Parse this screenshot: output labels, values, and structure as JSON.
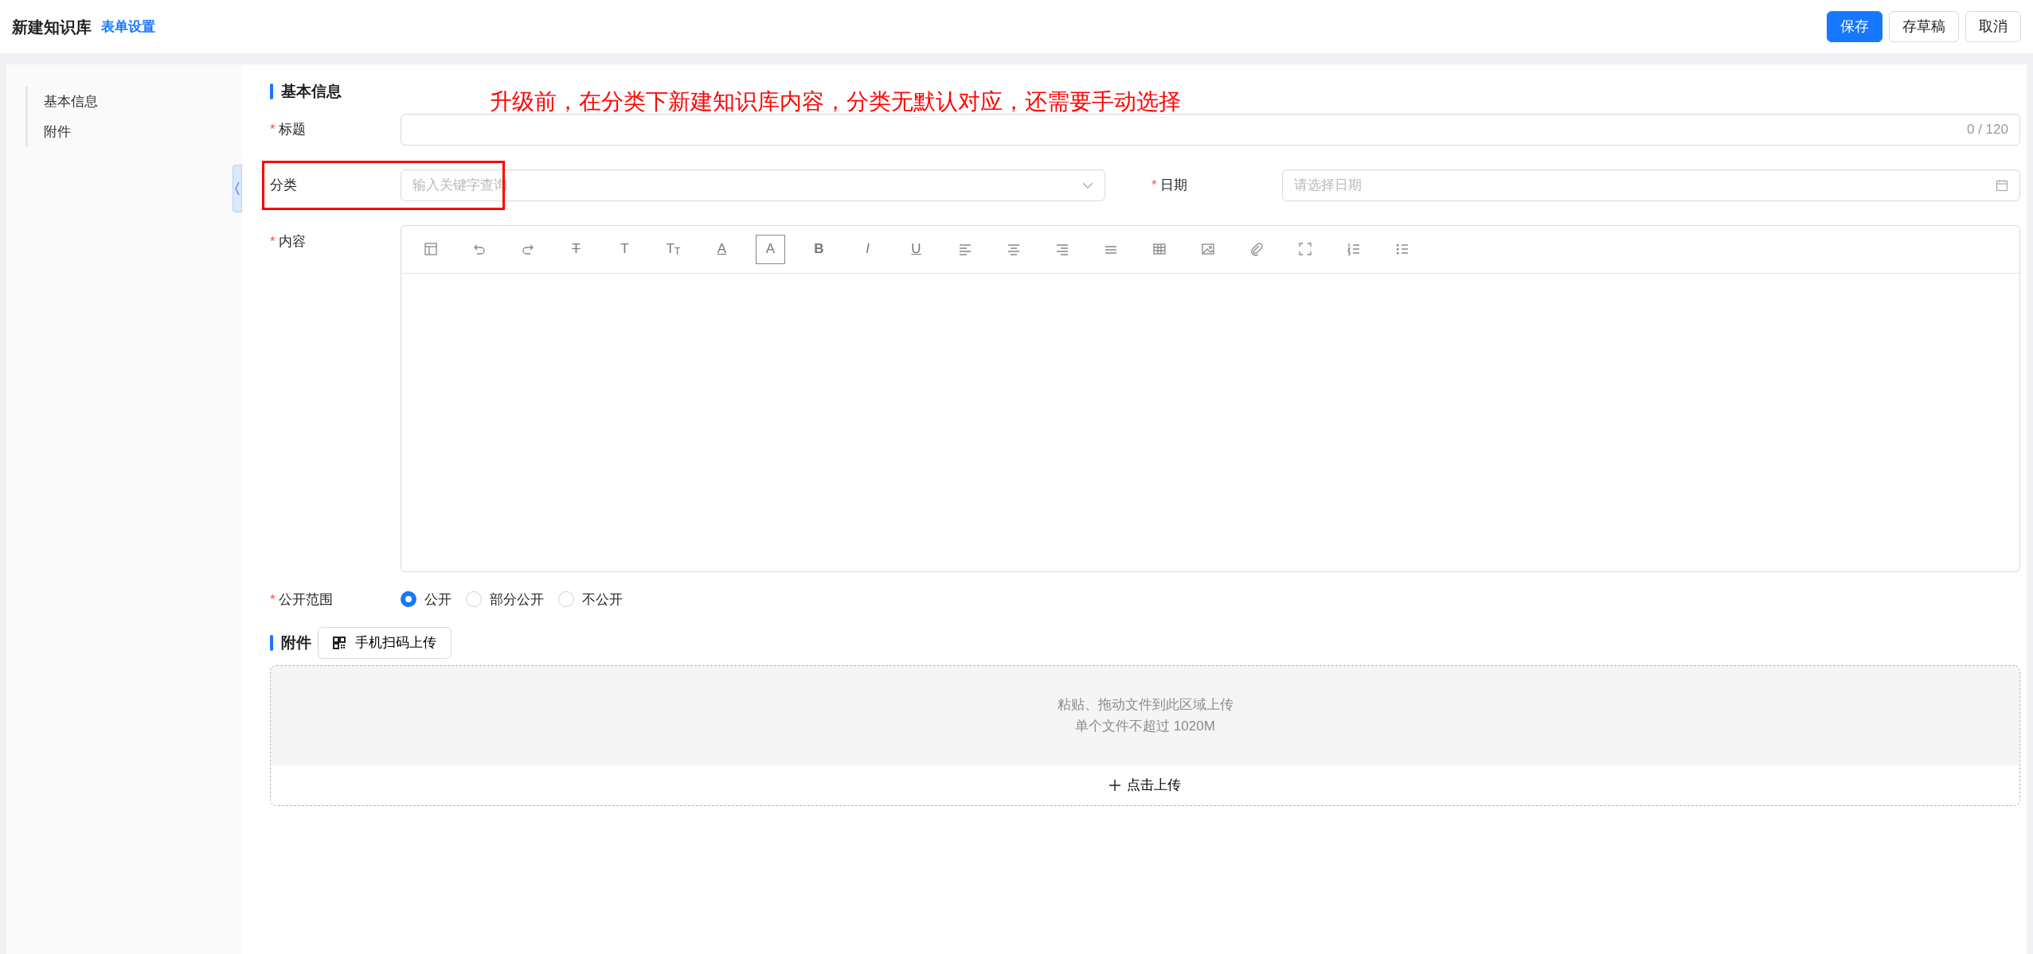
{
  "header": {
    "title": "新建知识库",
    "settings_link": "表单设置",
    "buttons": [
      {
        "label": "保存",
        "kind": "primary"
      },
      {
        "label": "存草稿",
        "kind": "default"
      },
      {
        "label": "取消",
        "kind": "default"
      }
    ]
  },
  "sidebar": {
    "items": [
      {
        "label": "基本信息"
      },
      {
        "label": "附件"
      }
    ]
  },
  "basic_info": {
    "heading": "基本信息",
    "title_field": {
      "label": "标题",
      "required_mark": "*",
      "counter": "0 / 120"
    },
    "category_field": {
      "label": "分类",
      "placeholder": "输入关键字查询"
    },
    "date_field": {
      "label": "日期",
      "required_mark": "*",
      "placeholder": "请选择日期"
    },
    "content_field": {
      "label": "内容",
      "required_mark": "*",
      "toolbar": [
        {
          "kind": "layout"
        },
        {
          "kind": "undo"
        },
        {
          "kind": "redo"
        },
        {
          "kind": "strike",
          "glyph": "T"
        },
        {
          "kind": "letter",
          "glyph": "T"
        },
        {
          "kind": "letter",
          "glyph": "T$_{T}$"
        },
        {
          "kind": "underlined",
          "glyph": "A"
        },
        {
          "kind": "boxed",
          "glyph": "A"
        },
        {
          "kind": "bold",
          "glyph": "B"
        },
        {
          "kind": "italic",
          "glyph": "I"
        },
        {
          "kind": "underlined",
          "glyph": "U"
        },
        {
          "kind": "align-left"
        },
        {
          "kind": "align-center"
        },
        {
          "kind": "align-right"
        },
        {
          "kind": "justify"
        },
        {
          "kind": "table"
        },
        {
          "kind": "image"
        },
        {
          "kind": "attachment"
        },
        {
          "kind": "fullscreen"
        },
        {
          "kind": "ordered-list"
        },
        {
          "kind": "bullet-list"
        }
      ]
    },
    "visibility": {
      "label": "公开范围",
      "required_mark": "*",
      "options": [
        {
          "label": "公开",
          "selected": true
        },
        {
          "label": "部分公开",
          "selected": false
        },
        {
          "label": "不公开",
          "selected": false
        }
      ]
    }
  },
  "attachments": {
    "heading": "附件",
    "scan_button": "手机扫码上传",
    "dropzone": {
      "hint": "粘贴、拖动文件到此区域上传",
      "limit": "单个文件不超过 1020M",
      "upload_button": "点击上传"
    }
  },
  "annotation": {
    "text": "升级前，在分类下新建知识库内容，分类无默认对应，还需要手动选择",
    "highlight_box": true
  }
}
